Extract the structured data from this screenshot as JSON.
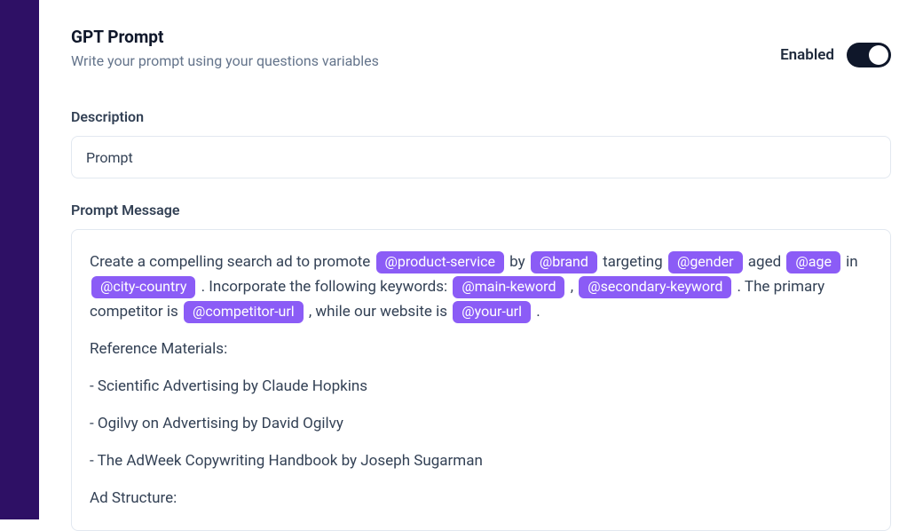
{
  "header": {
    "title": "GPT Prompt",
    "subtitle": "Write your prompt using your questions variables",
    "toggle_label": "Enabled",
    "toggle_on": true
  },
  "description": {
    "label": "Description",
    "value": "Prompt"
  },
  "prompt": {
    "label": "Prompt Message",
    "body": [
      {
        "type": "para",
        "items": [
          {
            "t": "text",
            "v": "Create a compelling search ad to promote "
          },
          {
            "t": "chip",
            "v": "@product-service"
          },
          {
            "t": "text",
            "v": " by "
          },
          {
            "t": "chip",
            "v": "@brand"
          },
          {
            "t": "text",
            "v": " targeting "
          },
          {
            "t": "chip",
            "v": "@gender"
          },
          {
            "t": "text",
            "v": " aged "
          },
          {
            "t": "chip",
            "v": "@age"
          },
          {
            "t": "text",
            "v": " in "
          },
          {
            "t": "chip",
            "v": "@city-country"
          },
          {
            "t": "text",
            "v": " . Incorporate the following keywords: "
          },
          {
            "t": "chip",
            "v": "@main-keword"
          },
          {
            "t": "text",
            "v": " , "
          },
          {
            "t": "chip",
            "v": "@secondary-keyword"
          },
          {
            "t": "text",
            "v": " . The primary competitor is "
          },
          {
            "t": "chip",
            "v": "@competitor-url"
          },
          {
            "t": "text",
            "v": " , while our website is "
          },
          {
            "t": "chip",
            "v": "@your-url"
          },
          {
            "t": "text",
            "v": " ."
          }
        ]
      },
      {
        "type": "para",
        "items": [
          {
            "t": "text",
            "v": "Reference Materials:"
          }
        ]
      },
      {
        "type": "para",
        "items": [
          {
            "t": "text",
            "v": "- Scientific Advertising by Claude Hopkins"
          }
        ]
      },
      {
        "type": "para",
        "items": [
          {
            "t": "text",
            "v": "- Ogilvy on Advertising by David Ogilvy"
          }
        ]
      },
      {
        "type": "para",
        "items": [
          {
            "t": "text",
            "v": "- The AdWeek Copywriting Handbook by Joseph Sugarman"
          }
        ]
      },
      {
        "type": "para",
        "items": [
          {
            "t": "text",
            "v": "Ad Structure:"
          }
        ]
      }
    ]
  }
}
